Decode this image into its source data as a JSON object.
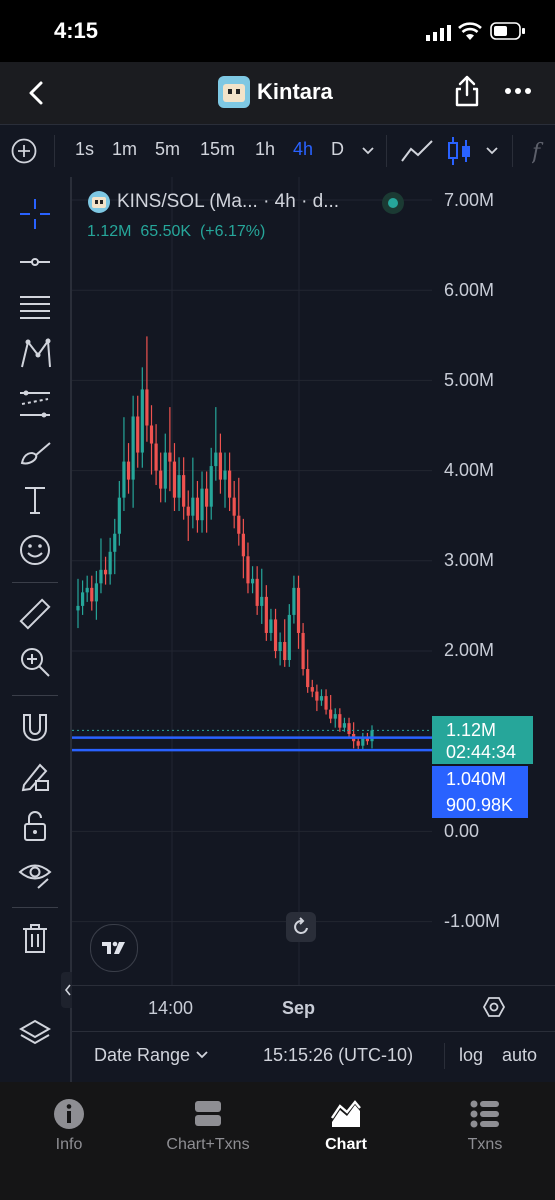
{
  "status_bar": {
    "time": "4:15"
  },
  "header": {
    "title": "Kintara"
  },
  "timeframes": [
    {
      "label": "1s",
      "active": false
    },
    {
      "label": "1m",
      "active": false
    },
    {
      "label": "5m",
      "active": false
    },
    {
      "label": "15m",
      "active": false
    },
    {
      "label": "1h",
      "active": false
    },
    {
      "label": "4h",
      "active": true
    },
    {
      "label": "D",
      "active": false
    }
  ],
  "legend": {
    "symbol": "KINS/SOL (Ma...",
    "interval": "· 4h · d...",
    "price": "1.12M",
    "change": "65.50K",
    "change_pct": "(+6.17%)"
  },
  "price_axis": {
    "labels": [
      "7.00M",
      "6.00M",
      "5.00M",
      "4.00M",
      "3.00M",
      "2.00M",
      "0.00",
      "-1.00M"
    ]
  },
  "time_axis": {
    "labels": [
      "14:00",
      "Sep"
    ]
  },
  "price_tags": {
    "last_price": "1.12M",
    "countdown": "02:44:34",
    "line1": "1.040M",
    "line2": "900.98K"
  },
  "bottom_bar": {
    "date_range": "Date Range",
    "clock": "15:15:26 (UTC-10)",
    "log": "log",
    "auto": "auto"
  },
  "tabs": [
    {
      "label": "Info",
      "icon": "info-icon",
      "active": false
    },
    {
      "label": "Chart+Txns",
      "icon": "split-view-icon",
      "active": false
    },
    {
      "label": "Chart",
      "icon": "chart-icon",
      "active": true
    },
    {
      "label": "Txns",
      "icon": "list-icon",
      "active": false
    }
  ],
  "colors": {
    "up": "#26a69a",
    "down": "#ef5350",
    "accent": "#2962ff",
    "chart_bg": "#131722"
  },
  "chart_data": {
    "type": "candlestick",
    "title": "KINS/SOL (Ma... · 4h · d...",
    "ylim": [
      -1500000,
      7300000
    ],
    "y_ticks": [
      7000000,
      6000000,
      5000000,
      4000000,
      3000000,
      2000000,
      0,
      -1000000
    ],
    "x_labels": [
      "14:00",
      "Sep"
    ],
    "last_price": 1120000,
    "horizontal_lines": [
      1040000,
      900980
    ],
    "close_series": [
      2500000,
      2650000,
      2700000,
      2550000,
      2750000,
      2900000,
      2850000,
      3100000,
      3300000,
      3700000,
      4100000,
      3900000,
      4600000,
      4200000,
      4900000,
      4500000,
      4300000,
      4000000,
      3800000,
      4200000,
      4100000,
      3700000,
      3950000,
      3600000,
      3500000,
      3700000,
      3450000,
      3800000,
      3600000,
      4050000,
      4200000,
      3900000,
      4000000,
      3700000,
      3500000,
      3300000,
      3050000,
      2750000,
      2800000,
      2500000,
      2600000,
      2200000,
      2350000,
      2000000,
      2100000,
      1900000,
      2400000,
      2700000,
      2200000,
      1800000,
      1600000,
      1550000,
      1450000,
      1500000,
      1350000,
      1250000,
      1300000,
      1150000,
      1200000,
      1080000,
      1000000,
      950000,
      1040000,
      1000000,
      1120000
    ]
  }
}
